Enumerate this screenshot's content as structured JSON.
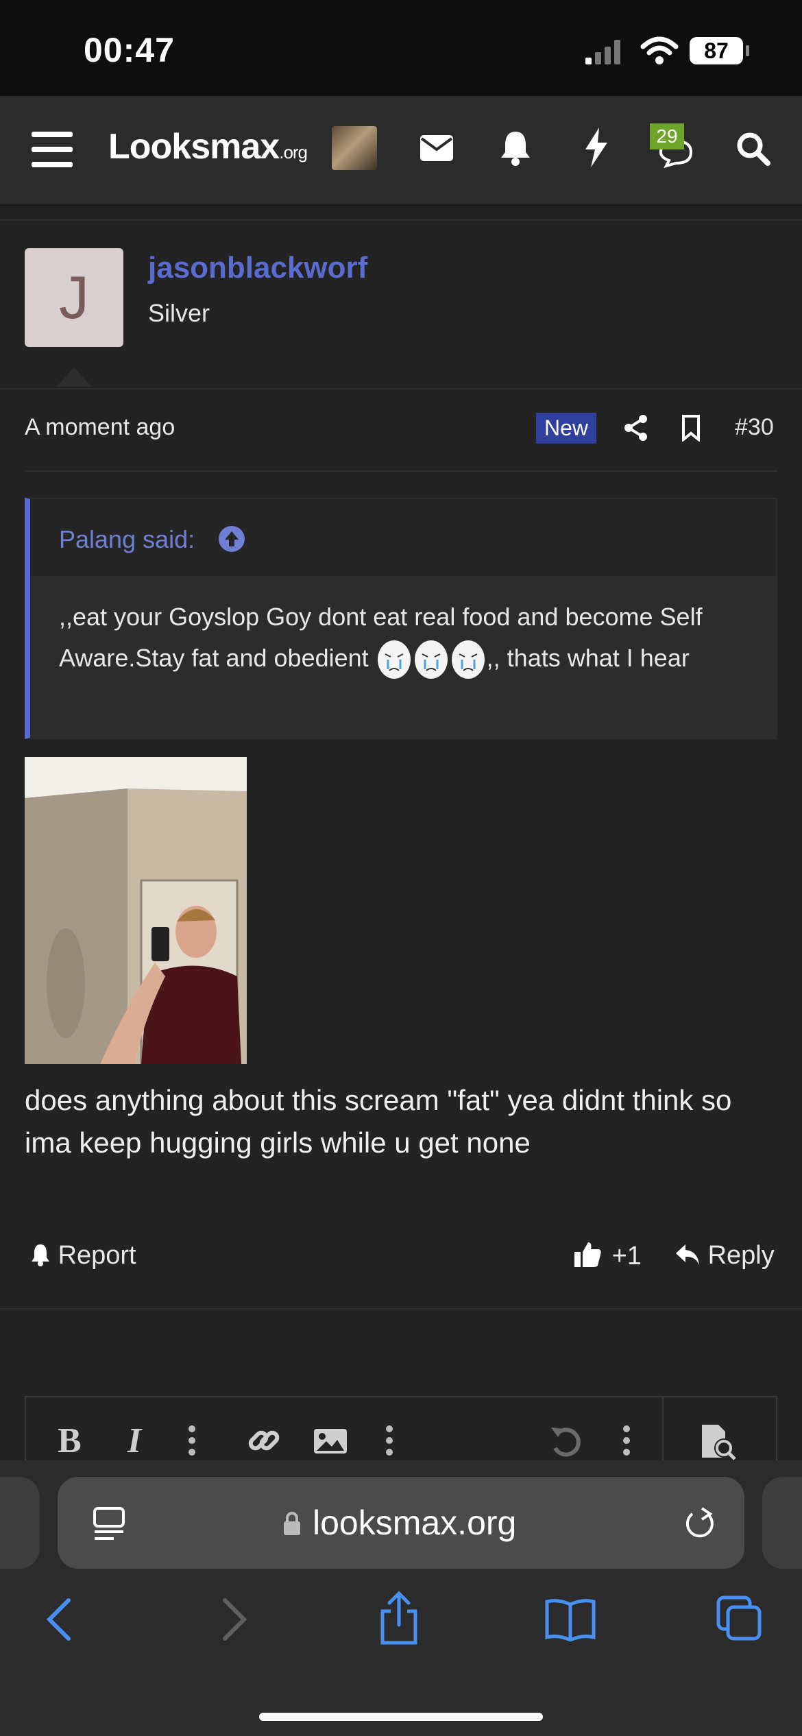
{
  "status_bar": {
    "time": "00:47",
    "battery": "87"
  },
  "nav": {
    "logo_main": "Looksmax",
    "logo_suffix": ".org",
    "conversations_badge": "29",
    "icons": [
      "menu-icon",
      "avatar-thumbnail",
      "envelope-icon",
      "bell-icon",
      "bolt-icon",
      "chat-search-icon",
      "search-icon"
    ]
  },
  "post": {
    "avatar_letter": "J",
    "username": "jasonblackworf",
    "user_title": "Silver",
    "timestamp": "A moment ago",
    "new_badge": "New",
    "post_number": "#30",
    "quote": {
      "author": "Palang said:",
      "text_before": ",,eat your Goyslop Goy dont eat real food and become Self Aware.Stay fat and obedient",
      "text_after": ",, thats what I hear"
    },
    "body_lines": [
      "does anything about this scream \"fat\" yea didnt think so",
      "ima keep hugging girls while u get none"
    ],
    "actions": {
      "report": "Report",
      "likes": "+1",
      "reply": "Reply"
    }
  },
  "browser": {
    "url": "looksmax.org"
  },
  "colors": {
    "accent": "#5a6ccf",
    "badge_green": "#6fa52a",
    "new_badge": "#2f3f9e"
  }
}
